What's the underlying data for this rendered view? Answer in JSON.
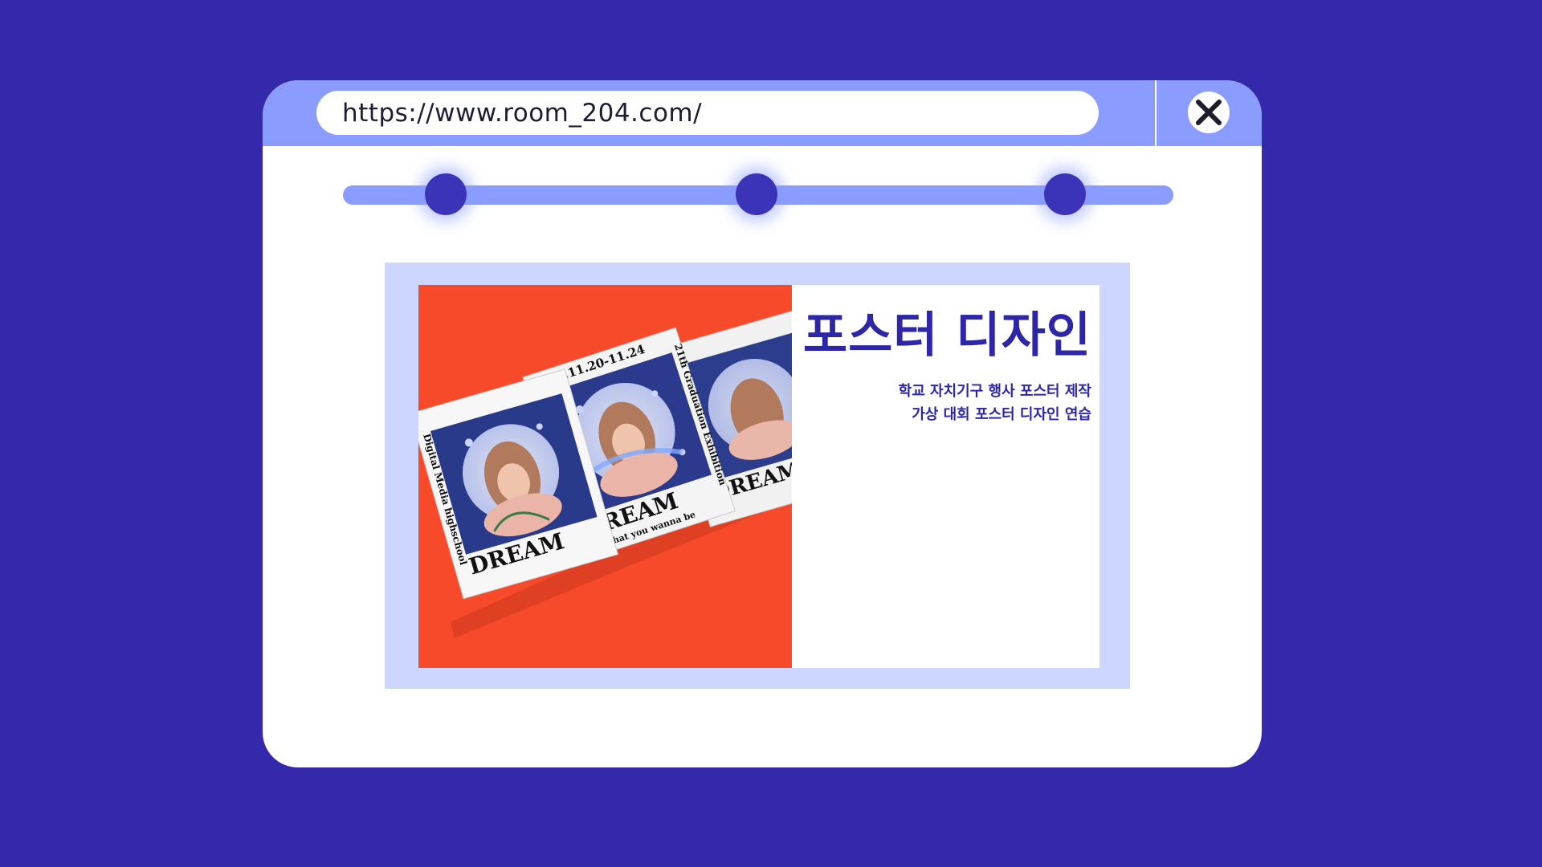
{
  "browser": {
    "url": "https://www.room_204.com/",
    "close_icon": "close-icon"
  },
  "slider": {
    "knob_count": 3
  },
  "card": {
    "title": "포스터 디자인",
    "description": [
      "학교 자치기구 행사 포스터 제작",
      "가상 대회 포스터 디자인 연습"
    ],
    "poster": {
      "date": "2022.11.20-11.24",
      "exhibition": "21th Graduation Exhibition",
      "school": "Digital Media highschool",
      "headline": "DREAM",
      "tagline": "Be what you wanna be"
    }
  },
  "colors": {
    "background": "#3529ab",
    "titlebar": "#8b9cff",
    "accent": "#2d27a8",
    "card_frame": "#ccd6ff",
    "poster_bg": "#f64a2b"
  }
}
